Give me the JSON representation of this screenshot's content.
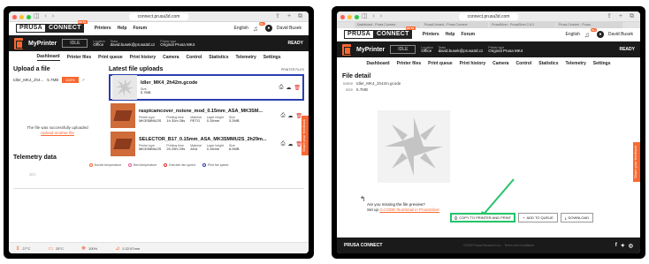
{
  "left": {
    "url": "connect.prusa3d.com",
    "logo": {
      "part1": "PRUSA",
      "part2": "CONNECT",
      "beta": "BETA"
    },
    "nav": [
      "Printers",
      "Help",
      "Forum"
    ],
    "language": "English",
    "notifications": "99+",
    "user": "David Busek",
    "printer": {
      "name": "MyPrinter",
      "state": "IDLE",
      "location_label": "Location",
      "location": "Office",
      "team_label": "Team",
      "team": "david.busek@prusa3d.cz",
      "type_label": "Printer type",
      "type": "Original Prusa MK4",
      "ready": "READY"
    },
    "tabs": [
      "Dashboard",
      "Printer files",
      "Print queue",
      "Print history",
      "Camera",
      "Control",
      "Statistics",
      "Telemetry",
      "Settings"
    ],
    "active_tab": "Dashboard",
    "upload": {
      "title": "Upload a file",
      "file": "Idler_MK4_2h4...",
      "size": "5.7MB",
      "progress": "100%",
      "success": "The file was successfully uploaded",
      "another": "Upload another file"
    },
    "latest": {
      "title": "Latest file uploads",
      "printer_files": "PRINTER FILES",
      "files": [
        {
          "name": "Idler_MK4_2h42m.gcode",
          "meta": [
            {
              "k": "Size",
              "v": "5.7MB"
            }
          ]
        },
        {
          "name": "raspicamcover_noisne_mod_0.15mm_ASA_MK3SM...",
          "meta": [
            {
              "k": "Printer type",
              "v": "MK3SMMU2S"
            },
            {
              "k": "Printing time",
              "v": "1h 32m 28s"
            },
            {
              "k": "Material",
              "v": "PETG"
            },
            {
              "k": "Layer height",
              "v": "0.15mm"
            },
            {
              "k": "Size",
              "v": "3.2MB"
            }
          ]
        },
        {
          "name": "SELECTOR_B17_0.15mm_ASA_MK3SMMU2S_2h29m...",
          "meta": [
            {
              "k": "Printer type",
              "v": "MK3SMMU2S"
            },
            {
              "k": "Printing time",
              "v": "2h 29m 29s"
            },
            {
              "k": "Material",
              "v": "ASA"
            },
            {
              "k": "Layer height",
              "v": "0.15mm"
            },
            {
              "k": "Size",
              "v": "6.0MB"
            }
          ]
        }
      ]
    },
    "telemetry": {
      "title": "Telemetry data",
      "legend": [
        {
          "label": "Nozzle temperature",
          "color": "#fa6831"
        },
        {
          "label": "Bed temperature",
          "color": "#e85d9b"
        },
        {
          "label": "Extruder fan speed",
          "color": "#e0312d"
        },
        {
          "label": "Print fan speed",
          "color": "#2a3eb1"
        }
      ],
      "axis": "25°C"
    },
    "status": [
      {
        "icon": "nozzle-icon",
        "glyph": "⊻",
        "value": "27°C"
      },
      {
        "icon": "bed-icon",
        "glyph": "▭",
        "value": "25°C"
      },
      {
        "icon": "fan-icon",
        "glyph": "✥",
        "value": "100%"
      },
      {
        "icon": "filament-icon",
        "glyph": "⊿",
        "value": "2:22:57mm"
      }
    ],
    "feedback": "Share your feedback"
  },
  "right": {
    "url": "connect.prusa3d.com",
    "tabs_browser": [
      "Dashboard - Prusa Connect",
      "PrusaConnect - Prusa Connect",
      "PrusaSlicer - PrusaSlicer 2.6.0",
      "Prusa Connect - Prusa..."
    ],
    "logo": {
      "part1": "PRUSA",
      "part2": "CONNECT",
      "beta": "BETA"
    },
    "nav": [
      "Printers",
      "Help",
      "Forum"
    ],
    "language": "English",
    "notifications": "99+",
    "user": "David Busek",
    "printer": {
      "name": "MyPrinter",
      "state": "IDLE",
      "location_label": "Location",
      "location": "Office",
      "team_label": "Team",
      "team": "david.busek@prusa3d.cz",
      "type_label": "Printer type",
      "type": "Original Prusa MK4",
      "ready": "READY"
    },
    "tabs": [
      "Dashboard",
      "Printer files",
      "Print queue",
      "Print history",
      "Camera",
      "Control",
      "Statistics",
      "Telemetry",
      "Settings"
    ],
    "detail": {
      "title": "File detail",
      "name_label": "name",
      "name": "Idler_MK4_2h42m.gcode",
      "size_label": "size",
      "size": "5.7MB",
      "missing": "Are you missing the file preview?",
      "setup_prefix": "Set up",
      "setup_link": "G-CODE thumbnail in PrusaSlicer"
    },
    "actions": {
      "copy": "COPY TO PRINTER AND PRINT",
      "queue": "ADD TO QUEUE",
      "download": "DOWNLOAD"
    },
    "footer": {
      "brand": "PRUSA CONNECT",
      "copy": "©2023 Prusa Research a.s. · Terms and Conditions"
    },
    "feedback": "Share your feedback",
    "accent": "#fa6831",
    "highlight": "#22c36a"
  }
}
